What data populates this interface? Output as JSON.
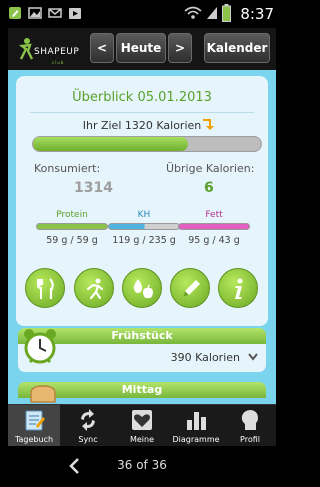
{
  "status_bar": {
    "time": "8:37"
  },
  "header": {
    "logo_text": "SHAPEUP",
    "logo_subtext": "club",
    "prev_label": "<",
    "day_label": "Heute",
    "next_label": ">",
    "calendar_label": "Kalender"
  },
  "overview": {
    "title": "Überblick 05.01.2013",
    "goal_text": "Ihr Ziel 1320 Kalorien",
    "goal_progress": 0.68,
    "consumed_label": "Konsumiert:",
    "consumed_value": "1314",
    "remaining_label": "Übrige Kalorien:",
    "remaining_value": "6"
  },
  "nutrients": [
    {
      "name": "Protein",
      "value": "59 g / 59 g",
      "fraction": 1.0,
      "color": "#8bc34a"
    },
    {
      "name": "KH",
      "value": "119 g / 235 g",
      "fraction": 0.51,
      "color": "#4fb3e0"
    },
    {
      "name": "Fett",
      "value": "95 g / 43 g",
      "fraction": 1.0,
      "color": "#e35fc0"
    }
  ],
  "actions": [
    {
      "icon": "fork-knife-icon"
    },
    {
      "icon": "running-icon"
    },
    {
      "icon": "drop-apple-icon"
    },
    {
      "icon": "pencil-icon"
    },
    {
      "icon": "info-icon"
    }
  ],
  "meals": [
    {
      "name": "Frühstück",
      "calories": "390 Kalorien"
    },
    {
      "name": "Mittag"
    }
  ],
  "tabs": [
    {
      "label": "Tagebuch",
      "icon": "notebook-icon",
      "active": true
    },
    {
      "label": "Sync",
      "icon": "sync-icon",
      "active": false
    },
    {
      "label": "Meine",
      "icon": "heart-icon",
      "active": false
    },
    {
      "label": "Diagramme",
      "icon": "bar-chart-icon",
      "active": false
    },
    {
      "label": "Profil",
      "icon": "profile-icon",
      "active": false
    }
  ],
  "viewer": {
    "pager": "36 of 36"
  },
  "colors": {
    "accent_green": "#5aa02c",
    "content_blue": "#7ad4ee",
    "remaining_green": "#5aa02c",
    "consumed_gray": "#9e9e9e"
  }
}
